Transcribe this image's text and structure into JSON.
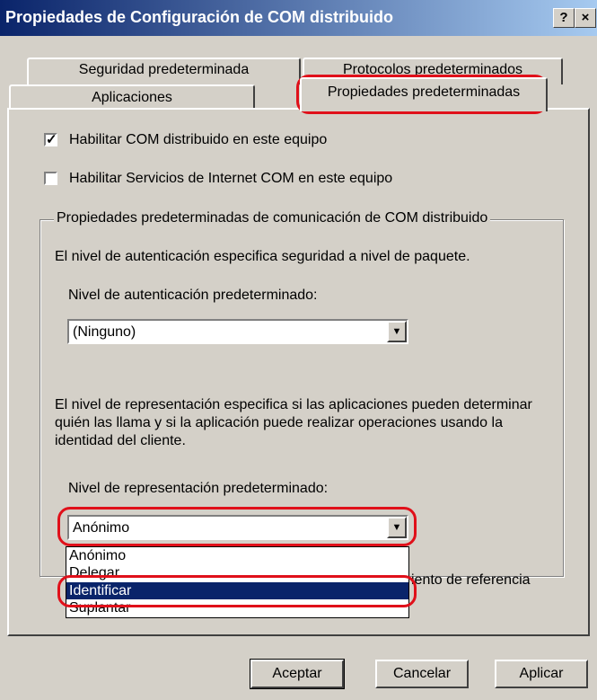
{
  "window": {
    "title": "Propiedades de Configuración de COM distribuido",
    "help_label": "?",
    "close_label": "×"
  },
  "tabs": {
    "row1": [
      "Seguridad predeterminada",
      "Protocolos predeterminados"
    ],
    "row2": [
      "Aplicaciones",
      "Propiedades predeterminadas"
    ],
    "active": "Propiedades predeterminadas"
  },
  "options": {
    "enable_dcom": {
      "label": "Habilitar COM distribuido en este equipo",
      "checked": true
    },
    "enable_cis": {
      "label": "Habilitar Servicios de Internet COM en este equipo",
      "checked": false
    }
  },
  "group": {
    "title": "Propiedades predeterminadas de comunicación de COM distribuido",
    "auth_description": "El nivel de autenticación especifica seguridad a nivel de paquete.",
    "auth_label": "Nivel de autenticación predeterminado:",
    "auth_value": "(Ninguno)",
    "imp_description": "El nivel de representación especifica si las aplicaciones pueden determinar quién las llama y si la aplicación puede realizar operaciones usando la identidad del cliente.",
    "imp_label": "Nivel de representación predeterminado:",
    "imp_value": "Anónimo",
    "imp_options": [
      "Anónimo",
      "Delegar",
      "Identificar",
      "Suplantar"
    ],
    "imp_highlighted": "Identificar",
    "partial_text": "iento de referencia"
  },
  "buttons": {
    "ok": "Aceptar",
    "cancel": "Cancelar",
    "apply": "Aplicar"
  },
  "colors": {
    "annotation": "#e0101a",
    "titlebar_start": "#0a246a",
    "selection": "#0a246a"
  }
}
